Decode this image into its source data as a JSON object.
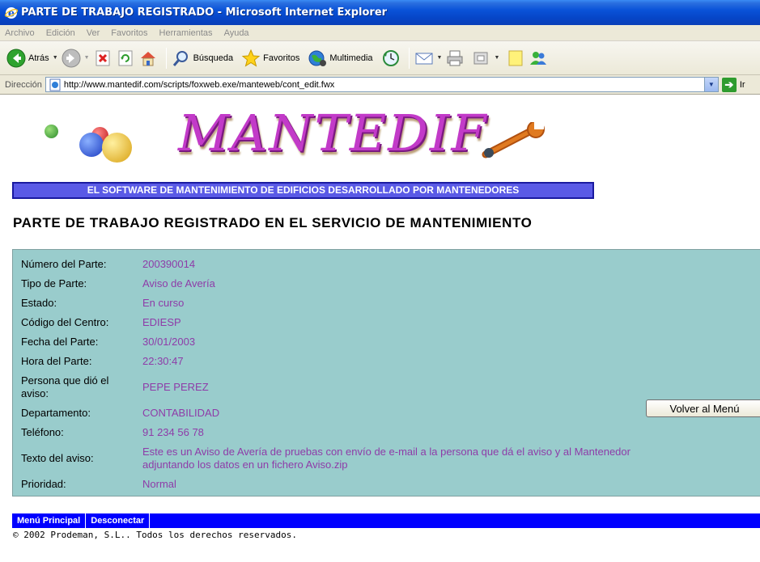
{
  "window": {
    "title": "PARTE DE TRABAJO REGISTRADO - Microsoft Internet Explorer"
  },
  "menubar": {
    "items": [
      "Archivo",
      "Edición",
      "Ver",
      "Favoritos",
      "Herramientas",
      "Ayuda"
    ]
  },
  "toolbar": {
    "back_label": "Atrás",
    "search_label": "Búsqueda",
    "favorites_label": "Favoritos",
    "multimedia_label": "Multimedia"
  },
  "address": {
    "label": "Dirección",
    "url": "http://www.mantedif.com/scripts/foxweb.exe/manteweb/cont_edit.fwx",
    "go_label": "Ir"
  },
  "page": {
    "logo_text": "MANTEDIF",
    "slogan": "EL SOFTWARE DE MANTENIMIENTO DE EDIFICIOS DESARROLLADO POR MANTENEDORES",
    "heading": "PARTE DE TRABAJO REGISTRADO EN EL SERVICIO DE MANTENIMIENTO",
    "fields": [
      {
        "key": "Número del Parte:",
        "value": "200390014"
      },
      {
        "key": "Tipo de Parte:",
        "value": "Aviso de Avería"
      },
      {
        "key": "Estado:",
        "value": "En curso"
      },
      {
        "key": "Código del Centro:",
        "value": "EDIESP"
      },
      {
        "key": "Fecha del Parte:",
        "value": "30/01/2003"
      },
      {
        "key": "Hora del Parte:",
        "value": "22:30:47"
      },
      {
        "key": "Persona que dió el aviso:",
        "value": "PEPE PEREZ"
      },
      {
        "key": "Departamento:",
        "value": "CONTABILIDAD"
      },
      {
        "key": "Teléfono:",
        "value": "91 234 56 78"
      },
      {
        "key": "Texto del aviso:",
        "value": "Este es un Aviso de Avería de pruebas con envío de e-mail a la persona que dá el aviso y al Mantenedor adjuntando los datos en un fichero Aviso.zip"
      },
      {
        "key": "Prioridad:",
        "value": "Normal"
      }
    ],
    "volver_label": "Volver al Menú",
    "footer_links": [
      "Menú Principal",
      "Desconectar"
    ],
    "copyright": "© 2002 Prodeman, S.L.. Todos los derechos reservados."
  },
  "colors": {
    "panel_bg": "#99cccc",
    "value_text": "#8e3ca8",
    "slogan_bg": "#5a5ae6",
    "footer_bar": "#0000ff"
  }
}
